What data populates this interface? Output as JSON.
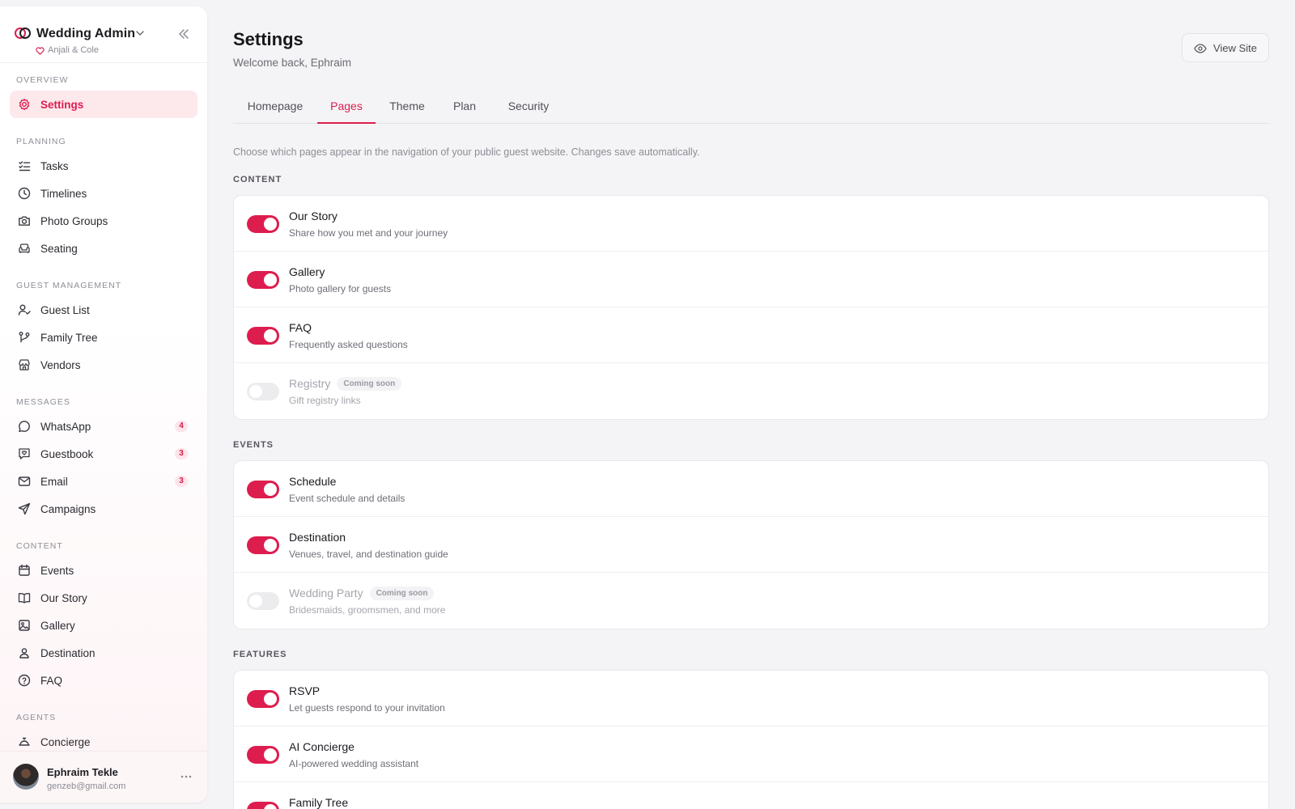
{
  "sidebar": {
    "brand_title": "Wedding Admin",
    "brand_subtitle": "Anjali & Cole",
    "sections": {
      "overview": "Overview",
      "planning": "Planning",
      "guest_management": "Guest Management",
      "messages": "Messages",
      "content": "Content",
      "agents": "Agents"
    },
    "items": {
      "settings": "Settings",
      "tasks": "Tasks",
      "timelines": "Timelines",
      "photo_groups": "Photo Groups",
      "seating": "Seating",
      "guest_list": "Guest List",
      "family_tree": "Family Tree",
      "vendors": "Vendors",
      "whatsapp": "WhatsApp",
      "guestbook": "Guestbook",
      "email": "Email",
      "campaigns": "Campaigns",
      "events": "Events",
      "our_story": "Our Story",
      "gallery": "Gallery",
      "destination": "Destination",
      "faq": "FAQ",
      "concierge": "Concierge"
    },
    "badges": {
      "whatsapp": "4",
      "guestbook": "3",
      "email": "3"
    },
    "user": {
      "name": "Ephraim Tekle",
      "email": "genzeb@gmail.com"
    }
  },
  "header": {
    "title": "Settings",
    "subtitle": "Welcome back, Ephraim",
    "view_site": "View Site"
  },
  "tabs": [
    "Homepage",
    "Pages",
    "Theme",
    "Plan",
    "Security"
  ],
  "active_tab": "Pages",
  "intro": "Choose which pages appear in the navigation of your public guest website. Changes save automatically.",
  "coming_soon": "Coming soon",
  "groups": {
    "content": {
      "label": "CONTENT",
      "rows": [
        {
          "title": "Our Story",
          "desc": "Share how you met and your journey",
          "enabled": true
        },
        {
          "title": "Gallery",
          "desc": "Photo gallery for guests",
          "enabled": true
        },
        {
          "title": "FAQ",
          "desc": "Frequently asked questions",
          "enabled": true
        },
        {
          "title": "Registry",
          "desc": "Gift registry links",
          "enabled": false
        }
      ]
    },
    "events": {
      "label": "EVENTS",
      "rows": [
        {
          "title": "Schedule",
          "desc": "Event schedule and details",
          "enabled": true
        },
        {
          "title": "Destination",
          "desc": "Venues, travel, and destination guide",
          "enabled": true
        },
        {
          "title": "Wedding Party",
          "desc": "Bridesmaids, groomsmen, and more",
          "enabled": false
        }
      ]
    },
    "features": {
      "label": "FEATURES",
      "rows": [
        {
          "title": "RSVP",
          "desc": "Let guests respond to your invitation",
          "enabled": true
        },
        {
          "title": "AI Concierge",
          "desc": "AI-powered wedding assistant",
          "enabled": true
        },
        {
          "title": "Family Tree",
          "desc": "",
          "enabled": true
        }
      ]
    }
  },
  "colors": {
    "accent": "#dc1e4f",
    "accent_soft": "#fde8ec",
    "toggle_off": "#ececef"
  }
}
